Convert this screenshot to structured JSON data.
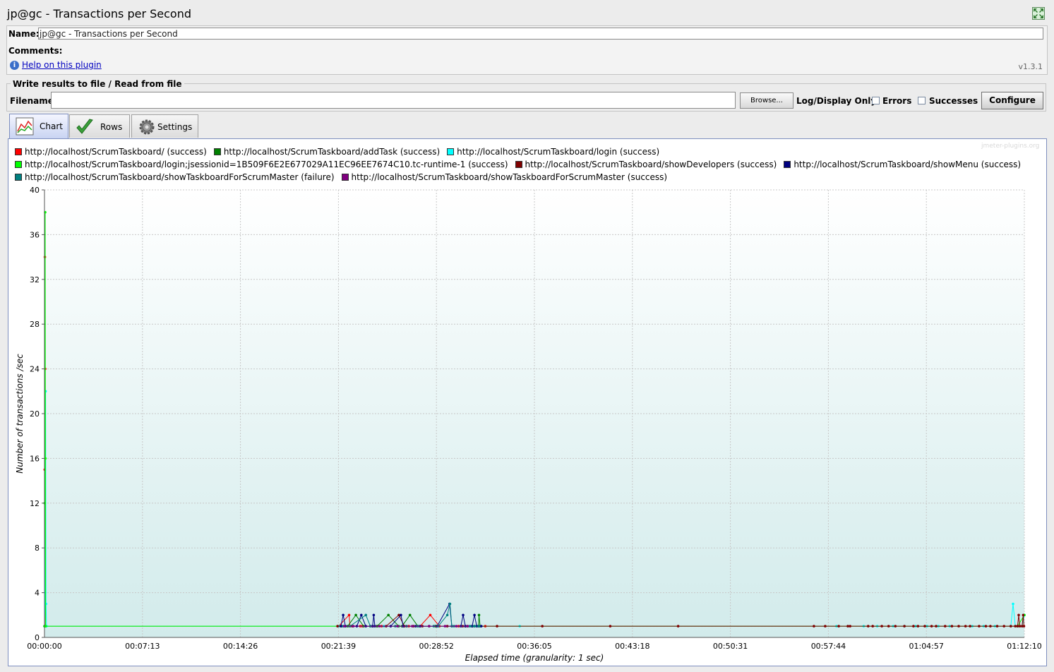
{
  "window": {
    "title": "jp@gc - Transactions per Second"
  },
  "name_panel": {
    "name_label": "Name:",
    "name_value": "jp@gc - Transactions per Second",
    "comments_label": "Comments:",
    "help_link": "Help on this plugin",
    "version": "v1.3.1"
  },
  "file_panel": {
    "group_title": "Write results to file / Read from file",
    "filename_label": "Filename",
    "filename_value": "",
    "browse_label": "Browse...",
    "log_display_label": "Log/Display Only:",
    "errors_label": "Errors",
    "errors_checked": false,
    "successes_label": "Successes",
    "successes_checked": false,
    "configure_label": "Configure"
  },
  "tabs": [
    {
      "label": "Chart",
      "icon": "chart-icon",
      "active": true
    },
    {
      "label": "Rows",
      "icon": "checkmark-icon",
      "active": false
    },
    {
      "label": "Settings",
      "icon": "gear-icon",
      "active": false
    }
  ],
  "chart": {
    "watermark": "jmeter-plugins.org",
    "legend": [
      {
        "label": "http://localhost/ScrumTaskboard/ (success)",
        "color": "#ff0000"
      },
      {
        "label": "http://localhost/ScrumTaskboard/addTask (success)",
        "color": "#008000"
      },
      {
        "label": "http://localhost/ScrumTaskboard/login (success)",
        "color": "#00ffff"
      },
      {
        "label": "http://localhost/ScrumTaskboard/login;jsessionid=1B509F6E2E677029A11EC96EE7674C10.tc-runtime-1 (success)",
        "color": "#00ff00"
      },
      {
        "label": "http://localhost/ScrumTaskboard/showDevelopers (success)",
        "color": "#800000"
      },
      {
        "label": "http://localhost/ScrumTaskboard/showMenu (success)",
        "color": "#000080"
      },
      {
        "label": "http://localhost/ScrumTaskboard/showTaskboardForScrumMaster (failure)",
        "color": "#008080"
      },
      {
        "label": "http://localhost/ScrumTaskboard/showTaskboardForScrumMaster (success)",
        "color": "#800080"
      }
    ]
  },
  "chart_data": {
    "type": "line",
    "xlabel": "Elapsed time (granularity: 1 sec)",
    "ylabel": "Number of transactions /sec",
    "x_unit": "seconds",
    "xlim": [
      0,
      4330
    ],
    "ylim": [
      0,
      40
    ],
    "x_ticks": [
      "00:00:00",
      "00:07:13",
      "00:14:26",
      "00:21:39",
      "00:28:52",
      "00:36:05",
      "00:43:18",
      "00:50:31",
      "00:57:44",
      "01:04:57",
      "01:12:10"
    ],
    "y_ticks": [
      0,
      4,
      8,
      12,
      16,
      20,
      24,
      28,
      32,
      36,
      40
    ],
    "grid": true,
    "legend_position": "top",
    "series": [
      {
        "name": "http://localhost/ScrumTaskboard/ (success)",
        "color": "#ff0000",
        "points": [
          [
            0,
            1
          ],
          [
            1,
            15
          ],
          [
            2,
            34
          ],
          [
            3,
            24
          ],
          [
            4,
            1
          ],
          [
            1300,
            1
          ],
          [
            1346,
            2
          ],
          [
            1350,
            1
          ],
          [
            1395,
            1
          ],
          [
            1404,
            1
          ],
          [
            1470,
            1
          ],
          [
            1490,
            1
          ],
          [
            1500,
            1
          ],
          [
            1600,
            1
          ],
          [
            1610,
            1
          ],
          [
            1660,
            1
          ],
          [
            1705,
            2
          ],
          [
            1745,
            1
          ],
          [
            1830,
            1
          ],
          [
            1860,
            1
          ],
          [
            1890,
            1
          ],
          [
            1920,
            1
          ],
          [
            1948,
            1
          ]
        ]
      },
      {
        "name": "http://localhost/ScrumTaskboard/addTask (success)",
        "color": "#008000",
        "points": [
          [
            1340,
            1
          ],
          [
            1376,
            2
          ],
          [
            1410,
            1
          ],
          [
            1440,
            1
          ],
          [
            1470,
            1
          ],
          [
            1520,
            2
          ],
          [
            1565,
            1
          ],
          [
            1580,
            1
          ],
          [
            1615,
            2
          ],
          [
            1650,
            1
          ],
          [
            1728,
            1
          ],
          [
            1732,
            1
          ],
          [
            1860,
            1
          ],
          [
            1890,
            1
          ],
          [
            1900,
            1
          ],
          [
            1918,
            1
          ],
          [
            1920,
            2
          ],
          [
            1925,
            1
          ]
        ]
      },
      {
        "name": "http://localhost/ScrumTaskboard/login (success)",
        "color": "#00ffff",
        "points": [
          [
            0,
            1
          ],
          [
            3,
            4
          ],
          [
            5,
            22
          ],
          [
            7,
            3
          ],
          [
            9,
            1
          ],
          [
            1300,
            1
          ],
          [
            1500,
            1
          ],
          [
            2100,
            1
          ],
          [
            3500,
            1
          ],
          [
            3550,
            1
          ],
          [
            3620,
            1
          ],
          [
            3680,
            1
          ],
          [
            3750,
            1
          ],
          [
            3800,
            1
          ],
          [
            3850,
            1
          ],
          [
            3900,
            1
          ],
          [
            3950,
            1
          ],
          [
            4000,
            1
          ],
          [
            4100,
            1
          ],
          [
            4150,
            1
          ],
          [
            4200,
            1
          ],
          [
            4270,
            1
          ],
          [
            4280,
            3
          ],
          [
            4290,
            1
          ],
          [
            4300,
            1
          ],
          [
            4320,
            1
          ],
          [
            4330,
            2
          ]
        ]
      },
      {
        "name": "http://localhost/ScrumTaskboard/login;jsessionid=1B509F6E2E677029A11EC96EE7674C10.tc-runtime-1 (success)",
        "color": "#00ff00",
        "points": [
          [
            0,
            1
          ],
          [
            1,
            12
          ],
          [
            3,
            38
          ],
          [
            4,
            16
          ],
          [
            5,
            1
          ],
          [
            4300,
            1
          ],
          [
            4330,
            2
          ]
        ]
      },
      {
        "name": "http://localhost/ScrumTaskboard/showDevelopers (success)",
        "color": "#800000",
        "points": [
          [
            1295,
            1
          ],
          [
            1312,
            1
          ],
          [
            1360,
            1
          ],
          [
            1450,
            1
          ],
          [
            1510,
            1
          ],
          [
            1566,
            2
          ],
          [
            1590,
            1
          ],
          [
            1630,
            1
          ],
          [
            1670,
            1
          ],
          [
            1700,
            1
          ],
          [
            1780,
            1
          ],
          [
            1848,
            1
          ],
          [
            1870,
            1
          ],
          [
            2000,
            1
          ],
          [
            2200,
            1
          ],
          [
            2500,
            1
          ],
          [
            2800,
            1
          ],
          [
            3400,
            1
          ],
          [
            3450,
            1
          ],
          [
            3510,
            1
          ],
          [
            3550,
            1
          ],
          [
            3560,
            1
          ],
          [
            3640,
            1
          ],
          [
            3660,
            1
          ],
          [
            3700,
            1
          ],
          [
            3730,
            1
          ],
          [
            3760,
            1
          ],
          [
            3800,
            1
          ],
          [
            3840,
            1
          ],
          [
            3860,
            1
          ],
          [
            3890,
            1
          ],
          [
            3920,
            1
          ],
          [
            3940,
            1
          ],
          [
            3980,
            1
          ],
          [
            4010,
            1
          ],
          [
            4040,
            1
          ],
          [
            4070,
            1
          ],
          [
            4090,
            1
          ],
          [
            4130,
            1
          ],
          [
            4160,
            1
          ],
          [
            4180,
            1
          ],
          [
            4210,
            1
          ],
          [
            4240,
            1
          ],
          [
            4270,
            1
          ],
          [
            4290,
            1
          ],
          [
            4300,
            1
          ],
          [
            4305,
            2
          ],
          [
            4310,
            1
          ],
          [
            4320,
            1
          ],
          [
            4325,
            2
          ],
          [
            4328,
            1
          ]
        ]
      },
      {
        "name": "http://localhost/ScrumTaskboard/showMenu (success)",
        "color": "#000080",
        "points": [
          [
            1310,
            1
          ],
          [
            1320,
            2
          ],
          [
            1330,
            1
          ],
          [
            1380,
            1
          ],
          [
            1400,
            2
          ],
          [
            1420,
            1
          ],
          [
            1450,
            1
          ],
          [
            1455,
            2
          ],
          [
            1460,
            1
          ],
          [
            1530,
            1
          ],
          [
            1575,
            2
          ],
          [
            1585,
            1
          ],
          [
            1640,
            1
          ],
          [
            1660,
            1
          ],
          [
            1735,
            1
          ],
          [
            1790,
            3
          ],
          [
            1800,
            1
          ],
          [
            1840,
            1
          ],
          [
            1850,
            2
          ],
          [
            1860,
            1
          ],
          [
            1890,
            1
          ],
          [
            1900,
            2
          ],
          [
            1910,
            1
          ],
          [
            1930,
            1
          ]
        ]
      },
      {
        "name": "http://localhost/ScrumTaskboard/showTaskboardForScrumMaster (failure)",
        "color": "#008080",
        "points": [
          [
            1320,
            1
          ],
          [
            1350,
            1
          ],
          [
            1420,
            2
          ],
          [
            1440,
            1
          ],
          [
            1550,
            1
          ],
          [
            1600,
            1
          ],
          [
            1650,
            1
          ],
          [
            1720,
            1
          ],
          [
            1740,
            1
          ],
          [
            1780,
            2
          ],
          [
            1792,
            3
          ],
          [
            1800,
            1
          ],
          [
            1810,
            1
          ],
          [
            1880,
            1
          ],
          [
            1900,
            1
          ],
          [
            1920,
            1
          ]
        ]
      },
      {
        "name": "http://localhost/ScrumTaskboard/showTaskboardForScrumMaster (success)",
        "color": "#800080",
        "points": [
          [
            1325,
            1
          ],
          [
            1365,
            1
          ],
          [
            1480,
            1
          ],
          [
            1560,
            1
          ],
          [
            1625,
            1
          ],
          [
            1700,
            1
          ],
          [
            1770,
            1
          ],
          [
            1820,
            1
          ],
          [
            1870,
            1
          ]
        ]
      }
    ]
  }
}
